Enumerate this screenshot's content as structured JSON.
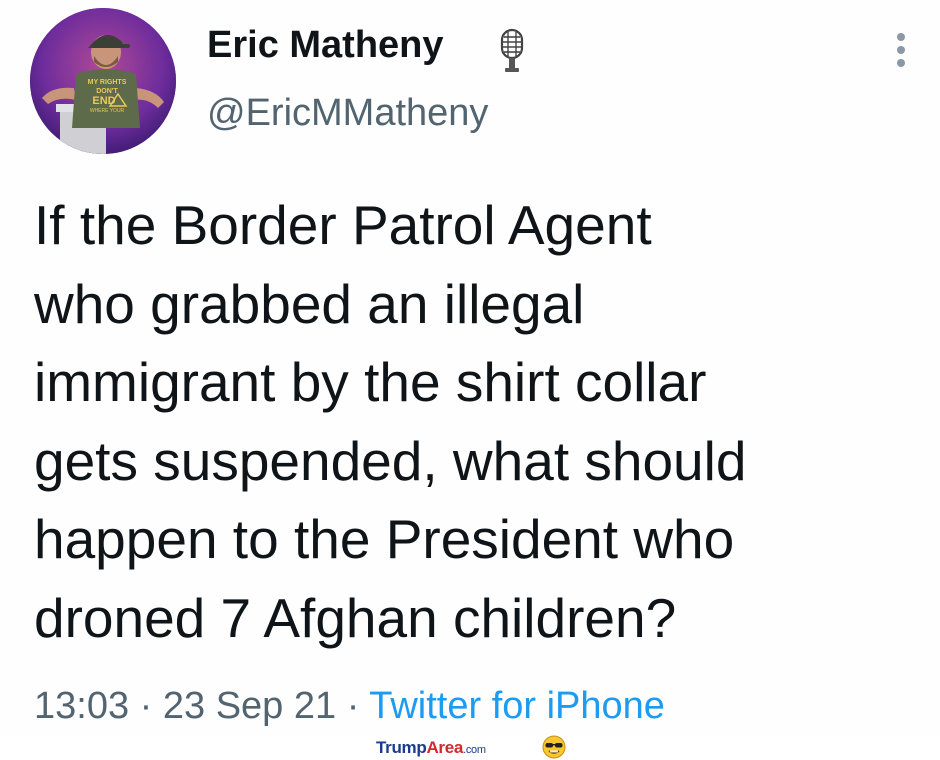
{
  "author": {
    "name": "Eric Matheny",
    "handle": "@EricMMatheny",
    "badge_icon": "microphone-icon",
    "avatar_shirt_text": [
      "MY RIGHTS",
      "DON'T",
      "END",
      "WHERE YOUR"
    ]
  },
  "tweet": {
    "lines": [
      "If the Border Patrol Agent",
      "who grabbed an illegal",
      "immigrant by the shirt collar",
      "gets suspended, what should",
      "happen to the President who",
      "droned 7 Afghan children?"
    ],
    "time": "13:03",
    "separator": " · ",
    "date": "23 Sep 21",
    "source": "Twitter for iPhone"
  },
  "menu": {
    "icon": "more-vertical-icon"
  },
  "watermark": {
    "brand_part1": "Trump",
    "brand_part2": "Area",
    "brand_part3": ".com",
    "emoji_icon": "sunglasses-face-icon"
  },
  "colors": {
    "text_primary": "#0f1419",
    "text_secondary": "#536471",
    "link": "#1d9bf0",
    "avatar_bg": "#6b2aa0"
  }
}
